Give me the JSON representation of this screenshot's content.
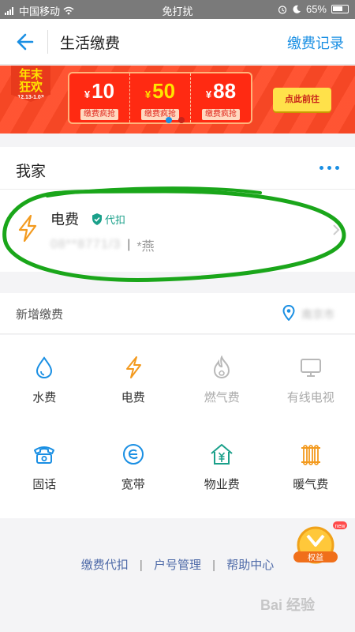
{
  "status_bar": {
    "carrier": "中国移动",
    "center": "免打扰",
    "battery": "65%"
  },
  "nav": {
    "title": "生活缴费",
    "record_link": "缴费记录"
  },
  "banner": {
    "badge_main": "年末\n狂欢",
    "badge_sub": "12.13-1.03",
    "coupons": [
      {
        "currency": "¥",
        "amount": "10",
        "tag": "缴费疯抢"
      },
      {
        "currency": "¥",
        "amount": "50",
        "tag": "缴费疯抢"
      },
      {
        "currency": "¥",
        "amount": "88",
        "tag": "缴费疯抢"
      }
    ],
    "cta": "点此前往"
  },
  "home": {
    "title": "我家",
    "bill": {
      "name": "电费",
      "badge": "代扣",
      "account": "08**8771/3",
      "holder": "*燕"
    }
  },
  "new_payment": {
    "label": "新增缴费",
    "location": "南京市"
  },
  "services": [
    {
      "label": "水费",
      "icon": "water-drop-icon"
    },
    {
      "label": "电费",
      "icon": "lightning-icon"
    },
    {
      "label": "燃气费",
      "icon": "flame-icon"
    },
    {
      "label": "有线电视",
      "icon": "tv-icon"
    },
    {
      "label": "固话",
      "icon": "telephone-icon"
    },
    {
      "label": "宽带",
      "icon": "broadband-icon"
    },
    {
      "label": "物业费",
      "icon": "house-yen-icon"
    },
    {
      "label": "暖气费",
      "icon": "radiator-icon"
    }
  ],
  "footer": {
    "links": [
      "缴费代扣",
      "户号管理",
      "帮助中心"
    ]
  },
  "rights_badge": {
    "new": "new",
    "label": "权益"
  },
  "watermark": "Bai 经验",
  "colors": {
    "accent": "#1a8fe3",
    "banner": "#ff4a26",
    "orange": "#f39a1e",
    "green": "#1aa08a"
  }
}
